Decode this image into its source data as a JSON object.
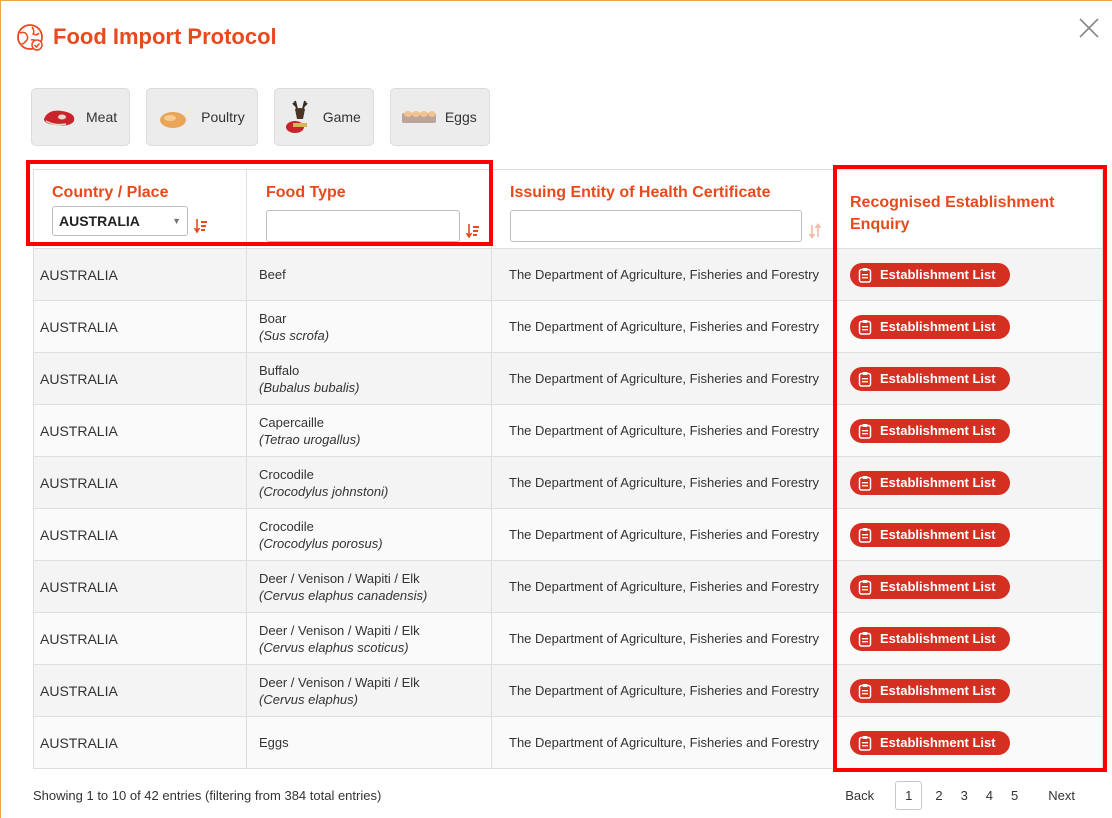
{
  "title": "Food Import Protocol",
  "categories": [
    {
      "label": "Meat",
      "icon": "meat-icon"
    },
    {
      "label": "Poultry",
      "icon": "poultry-icon"
    },
    {
      "label": "Game",
      "icon": "game-icon"
    },
    {
      "label": "Eggs",
      "icon": "eggs-icon"
    }
  ],
  "columns": {
    "country": "Country / Place",
    "food": "Food Type",
    "issuer": "Issuing Entity of Health Certificate",
    "establishment": "Recognised Establishment Enquiry"
  },
  "filters": {
    "country_selected": "AUSTRALIA",
    "food_value": "",
    "issuer_value": ""
  },
  "rows": [
    {
      "country": "AUSTRALIA",
      "food": "Beef",
      "scientific": "",
      "issuer": "The Department of Agriculture, Fisheries and Forestry",
      "button": "Establishment List"
    },
    {
      "country": "AUSTRALIA",
      "food": "Boar",
      "scientific": "(Sus scrofa)",
      "issuer": "The Department of Agriculture, Fisheries and Forestry",
      "button": "Establishment List"
    },
    {
      "country": "AUSTRALIA",
      "food": "Buffalo",
      "scientific": "(Bubalus bubalis)",
      "issuer": "The Department of Agriculture, Fisheries and Forestry",
      "button": "Establishment List"
    },
    {
      "country": "AUSTRALIA",
      "food": "Capercaille",
      "scientific": "(Tetrao urogallus)",
      "issuer": "The Department of Agriculture, Fisheries and Forestry",
      "button": "Establishment List"
    },
    {
      "country": "AUSTRALIA",
      "food": "Crocodile",
      "scientific": "(Crocodylus johnstoni)",
      "issuer": "The Department of Agriculture, Fisheries and Forestry",
      "button": "Establishment List"
    },
    {
      "country": "AUSTRALIA",
      "food": "Crocodile",
      "scientific": "(Crocodylus porosus)",
      "issuer": "The Department of Agriculture, Fisheries and Forestry",
      "button": "Establishment List"
    },
    {
      "country": "AUSTRALIA",
      "food": "Deer / Venison / Wapiti / Elk",
      "scientific": "(Cervus elaphus canadensis)",
      "issuer": "The Department of Agriculture, Fisheries and Forestry",
      "button": "Establishment List"
    },
    {
      "country": "AUSTRALIA",
      "food": "Deer / Venison / Wapiti / Elk",
      "scientific": "(Cervus elaphus scoticus)",
      "issuer": "The Department of Agriculture, Fisheries and Forestry",
      "button": "Establishment List"
    },
    {
      "country": "AUSTRALIA",
      "food": "Deer / Venison / Wapiti / Elk",
      "scientific": "(Cervus elaphus)",
      "issuer": "The Department of Agriculture, Fisheries and Forestry",
      "button": "Establishment List"
    },
    {
      "country": "AUSTRALIA",
      "food": "Eggs",
      "scientific": "",
      "issuer": "The Department of Agriculture, Fisheries and Forestry",
      "button": "Establishment List"
    }
  ],
  "footer": {
    "info": "Showing 1 to 10 of 42 entries (filtering from 384 total entries)",
    "back": "Back",
    "pages": [
      "1",
      "2",
      "3",
      "4",
      "5"
    ],
    "current_page": "1",
    "next": "Next"
  },
  "colors": {
    "accent": "#e8491d",
    "button_red": "#d42f20",
    "highlight_box": "#ff0000"
  }
}
